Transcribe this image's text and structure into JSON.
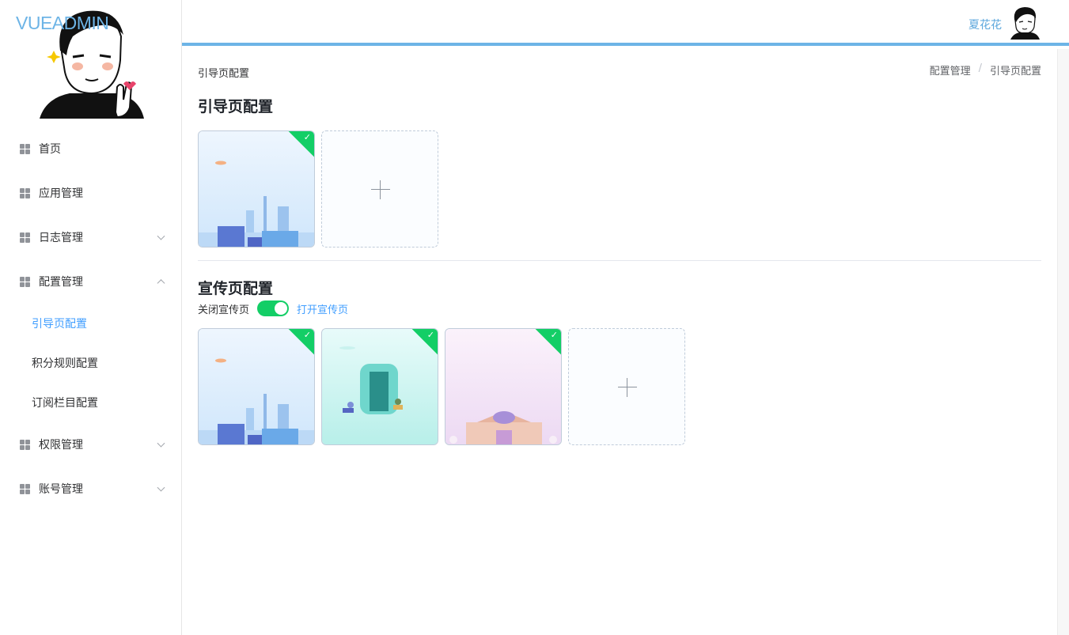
{
  "sidebar": {
    "logo": "VUEADMIN",
    "menu": [
      {
        "label": "首页"
      },
      {
        "label": "应用管理"
      },
      {
        "label": "日志管理"
      },
      {
        "label": "配置管理"
      },
      {
        "label": "权限管理"
      },
      {
        "label": "账号管理"
      }
    ],
    "submenu": [
      {
        "label": "引导页配置",
        "active": true
      },
      {
        "label": "积分规则配置"
      },
      {
        "label": "订阅栏目配置"
      }
    ]
  },
  "header": {
    "username": "夏花花"
  },
  "page": {
    "label": "引导页配置",
    "breadcrumb": [
      "配置管理",
      "/",
      "引导页配置"
    ],
    "guide_title": "引导页配置",
    "promo_title": "宣传页配置",
    "switch_off_label": "关闭宣传页",
    "switch_on_label": "打开宣传页",
    "switch_enabled": true
  },
  "colors": {
    "accent": "#6db4e6",
    "success": "#13ce66",
    "active_link": "#409eff"
  },
  "icons": {
    "menu_icon": "grid-icon",
    "upload_icon": "plus-icon",
    "badge_icon": "check-icon"
  }
}
